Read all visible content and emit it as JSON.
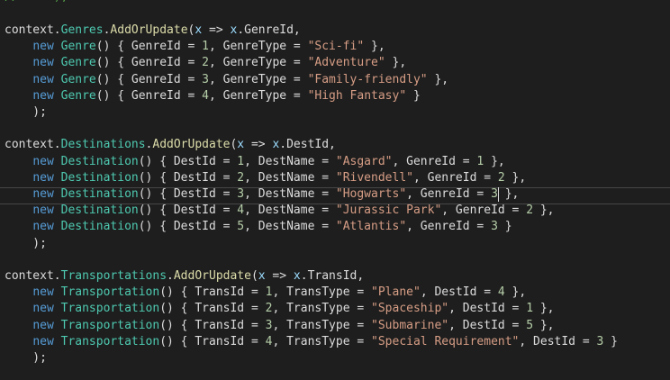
{
  "colors": {
    "background": "#1e1e1e",
    "plain": "#dcdcdc",
    "keyword": "#569cd6",
    "type": "#4ec9b0",
    "method": "#dcdcaa",
    "variable": "#9cdcfe",
    "string": "#d69d85",
    "number": "#b5cea8",
    "comment": "#57a64a",
    "current_line_border": "#464646"
  },
  "editor": {
    "partial_top_line": "// ... );",
    "lines": [
      [
        [
          "plain",
          "context."
        ],
        [
          "type",
          "Genres"
        ],
        [
          "plain",
          "."
        ],
        [
          "method",
          "AddOrUpdate"
        ],
        [
          "plain",
          "("
        ],
        [
          "variable",
          "x"
        ],
        [
          "plain",
          " => "
        ],
        [
          "variable",
          "x"
        ],
        [
          "plain",
          ".GenreId,"
        ]
      ],
      [
        [
          "plain",
          "    "
        ],
        [
          "keyword",
          "new"
        ],
        [
          "plain",
          " "
        ],
        [
          "type",
          "Genre"
        ],
        [
          "plain",
          "() { GenreId = "
        ],
        [
          "number",
          "1"
        ],
        [
          "plain",
          ", GenreType = "
        ],
        [
          "string",
          "\"Sci-fi\""
        ],
        [
          "plain",
          " },"
        ]
      ],
      [
        [
          "plain",
          "    "
        ],
        [
          "keyword",
          "new"
        ],
        [
          "plain",
          " "
        ],
        [
          "type",
          "Genre"
        ],
        [
          "plain",
          "() { GenreId = "
        ],
        [
          "number",
          "2"
        ],
        [
          "plain",
          ", GenreType = "
        ],
        [
          "string",
          "\"Adventure\""
        ],
        [
          "plain",
          " },"
        ]
      ],
      [
        [
          "plain",
          "    "
        ],
        [
          "keyword",
          "new"
        ],
        [
          "plain",
          " "
        ],
        [
          "type",
          "Genre"
        ],
        [
          "plain",
          "() { GenreId = "
        ],
        [
          "number",
          "3"
        ],
        [
          "plain",
          ", GenreType = "
        ],
        [
          "string",
          "\"Family-friendly\""
        ],
        [
          "plain",
          " },"
        ]
      ],
      [
        [
          "plain",
          "    "
        ],
        [
          "keyword",
          "new"
        ],
        [
          "plain",
          " "
        ],
        [
          "type",
          "Genre"
        ],
        [
          "plain",
          "() { GenreId = "
        ],
        [
          "number",
          "4"
        ],
        [
          "plain",
          ", GenreType = "
        ],
        [
          "string",
          "\"High Fantasy\""
        ],
        [
          "plain",
          " }"
        ]
      ],
      [
        [
          "plain",
          "    );"
        ]
      ],
      [],
      [
        [
          "plain",
          "context."
        ],
        [
          "type",
          "Destinations"
        ],
        [
          "plain",
          "."
        ],
        [
          "method",
          "AddOrUpdate"
        ],
        [
          "plain",
          "("
        ],
        [
          "variable",
          "x"
        ],
        [
          "plain",
          " => "
        ],
        [
          "variable",
          "x"
        ],
        [
          "plain",
          ".DestId,"
        ]
      ],
      [
        [
          "plain",
          "    "
        ],
        [
          "keyword",
          "new"
        ],
        [
          "plain",
          " "
        ],
        [
          "type",
          "Destination"
        ],
        [
          "plain",
          "() { DestId = "
        ],
        [
          "number",
          "1"
        ],
        [
          "plain",
          ", DestName = "
        ],
        [
          "string",
          "\"Asgard\""
        ],
        [
          "plain",
          ", GenreId = "
        ],
        [
          "number",
          "1"
        ],
        [
          "plain",
          " },"
        ]
      ],
      [
        [
          "plain",
          "    "
        ],
        [
          "keyword",
          "new"
        ],
        [
          "plain",
          " "
        ],
        [
          "type",
          "Destination"
        ],
        [
          "plain",
          "() { DestId = "
        ],
        [
          "number",
          "2"
        ],
        [
          "plain",
          ", DestName = "
        ],
        [
          "string",
          "\"Rivendell\""
        ],
        [
          "plain",
          ", GenreId = "
        ],
        [
          "number",
          "2"
        ],
        [
          "plain",
          " },"
        ]
      ],
      [
        [
          "plain",
          "    "
        ],
        [
          "keyword",
          "new"
        ],
        [
          "plain",
          " "
        ],
        [
          "type",
          "Destination"
        ],
        [
          "plain",
          "() { DestId = "
        ],
        [
          "number",
          "3"
        ],
        [
          "plain",
          ", DestName = "
        ],
        [
          "string",
          "\"Hogwarts\""
        ],
        [
          "plain",
          ", GenreId = "
        ],
        [
          "number",
          "3"
        ],
        [
          "plain",
          " },"
        ]
      ],
      [
        [
          "plain",
          "    "
        ],
        [
          "keyword",
          "new"
        ],
        [
          "plain",
          " "
        ],
        [
          "type",
          "Destination"
        ],
        [
          "plain",
          "() { DestId = "
        ],
        [
          "number",
          "4"
        ],
        [
          "plain",
          ", DestName = "
        ],
        [
          "string",
          "\"Jurassic Park\""
        ],
        [
          "plain",
          ", GenreId = "
        ],
        [
          "number",
          "2"
        ],
        [
          "plain",
          " },"
        ]
      ],
      [
        [
          "plain",
          "    "
        ],
        [
          "keyword",
          "new"
        ],
        [
          "plain",
          " "
        ],
        [
          "type",
          "Destination"
        ],
        [
          "plain",
          "() { DestId = "
        ],
        [
          "number",
          "5"
        ],
        [
          "plain",
          ", DestName = "
        ],
        [
          "string",
          "\"Atlantis\""
        ],
        [
          "plain",
          ", GenreId = "
        ],
        [
          "number",
          "3"
        ],
        [
          "plain",
          " }"
        ]
      ],
      [
        [
          "plain",
          "    );"
        ]
      ],
      [],
      [
        [
          "plain",
          "context."
        ],
        [
          "type",
          "Transportations"
        ],
        [
          "plain",
          "."
        ],
        [
          "method",
          "AddOrUpdate"
        ],
        [
          "plain",
          "("
        ],
        [
          "variable",
          "x"
        ],
        [
          "plain",
          " => "
        ],
        [
          "variable",
          "x"
        ],
        [
          "plain",
          ".TransId,"
        ]
      ],
      [
        [
          "plain",
          "    "
        ],
        [
          "keyword",
          "new"
        ],
        [
          "plain",
          " "
        ],
        [
          "type",
          "Transportation"
        ],
        [
          "plain",
          "() { TransId = "
        ],
        [
          "number",
          "1"
        ],
        [
          "plain",
          ", TransType = "
        ],
        [
          "string",
          "\"Plane\""
        ],
        [
          "plain",
          ", DestId = "
        ],
        [
          "number",
          "4"
        ],
        [
          "plain",
          " },"
        ]
      ],
      [
        [
          "plain",
          "    "
        ],
        [
          "keyword",
          "new"
        ],
        [
          "plain",
          " "
        ],
        [
          "type",
          "Transportation"
        ],
        [
          "plain",
          "() { TransId = "
        ],
        [
          "number",
          "2"
        ],
        [
          "plain",
          ", TransType = "
        ],
        [
          "string",
          "\"Spaceship\""
        ],
        [
          "plain",
          ", DestId = "
        ],
        [
          "number",
          "1"
        ],
        [
          "plain",
          " },"
        ]
      ],
      [
        [
          "plain",
          "    "
        ],
        [
          "keyword",
          "new"
        ],
        [
          "plain",
          " "
        ],
        [
          "type",
          "Transportation"
        ],
        [
          "plain",
          "() { TransId = "
        ],
        [
          "number",
          "3"
        ],
        [
          "plain",
          ", TransType = "
        ],
        [
          "string",
          "\"Submarine\""
        ],
        [
          "plain",
          ", DestId = "
        ],
        [
          "number",
          "5"
        ],
        [
          "plain",
          " },"
        ]
      ],
      [
        [
          "plain",
          "    "
        ],
        [
          "keyword",
          "new"
        ],
        [
          "plain",
          " "
        ],
        [
          "type",
          "Transportation"
        ],
        [
          "plain",
          "() { TransId = "
        ],
        [
          "number",
          "4"
        ],
        [
          "plain",
          ", TransType = "
        ],
        [
          "string",
          "\"Special Requirement\""
        ],
        [
          "plain",
          ", DestId = "
        ],
        [
          "number",
          "3"
        ],
        [
          "plain",
          " }"
        ]
      ],
      [
        [
          "plain",
          "    );"
        ]
      ]
    ]
  }
}
